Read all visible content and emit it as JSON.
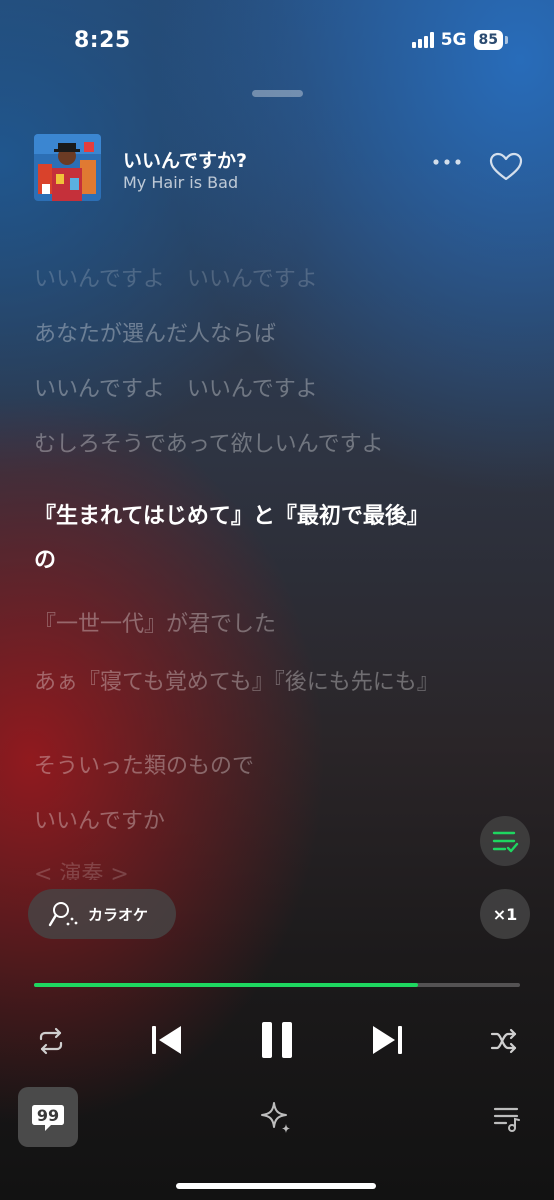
{
  "status_bar": {
    "time": "8:25",
    "network": "5G",
    "battery": "85"
  },
  "now_playing": {
    "title": "いいんですか?",
    "artist": "My Hair is Bad"
  },
  "lyrics": [
    {
      "text": "いいんですよ　いいんですよ",
      "state": "faded"
    },
    {
      "text": "あなたが選んだ人ならば",
      "state": "past"
    },
    {
      "text": "いいんですよ　いいんですよ",
      "state": "past"
    },
    {
      "text": "むしろそうであって欲しいんですよ",
      "state": "past"
    },
    {
      "text": "『生まれてはじめて』と『最初で最後』の",
      "state": "active"
    },
    {
      "text": "『一世一代』が君でした",
      "state": "upcoming"
    },
    {
      "text": "あぁ『寝ても覚めても』『後にも先にも』",
      "state": "upcoming"
    },
    {
      "text": "そういった類のもので",
      "state": "upcoming"
    },
    {
      "text": "いいんですか",
      "state": "upcoming"
    },
    {
      "text": "< 演奏 >",
      "state": "faded"
    }
  ],
  "karaoke_label": "カラオケ",
  "speed_label": "×1",
  "progress": 0.79,
  "colors": {
    "accent": "#1ed760"
  },
  "icons": {
    "more": "more-dots-icon",
    "like": "heart-icon",
    "queue": "queue-check-icon",
    "karaoke": "microphone-icon",
    "repeat": "repeat-icon",
    "previous": "skip-previous-icon",
    "pause": "pause-icon",
    "next": "skip-next-icon",
    "shuffle": "shuffle-icon",
    "lyrics": "lyrics-quote-icon",
    "ai": "sparkle-icon",
    "playlist": "playlist-icon"
  }
}
